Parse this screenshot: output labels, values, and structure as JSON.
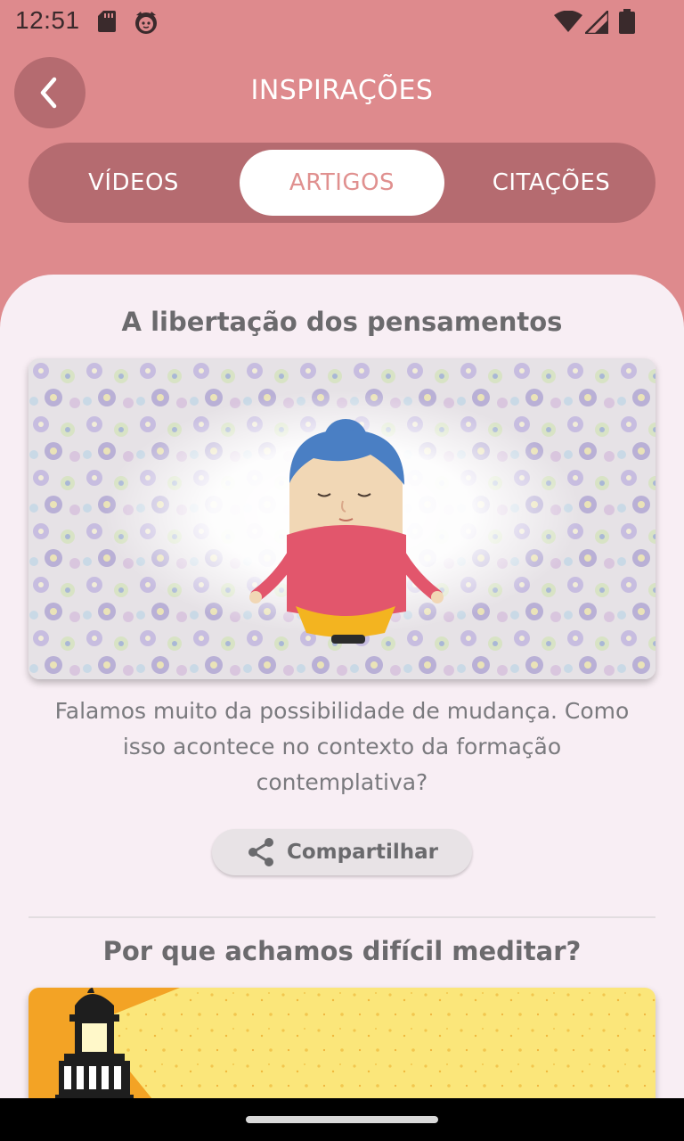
{
  "status_bar": {
    "time": "12:51",
    "icons": [
      "sd-card-icon",
      "cat-notification-icon",
      "wifi-icon",
      "signal-icon",
      "battery-icon"
    ]
  },
  "header": {
    "title": "INSPIRAÇÕES",
    "back_icon": "chevron-left-icon"
  },
  "tabs": [
    {
      "label": "VÍDEOS",
      "selected": false
    },
    {
      "label": "ARTIGOS",
      "selected": true
    },
    {
      "label": "CITAÇÕES",
      "selected": false
    }
  ],
  "articles": [
    {
      "title": "A libertação dos pensamentos",
      "description": "Falamos muito da possibilidade de mudança. Como isso acontece no contexto da formação contemplativa?",
      "share_label": "Compartilhar",
      "share_icon": "share-icon"
    },
    {
      "title": "Por que achamos difícil meditar?"
    }
  ],
  "colors": {
    "header_bg": "#de8a8d",
    "tab_bar_bg": "#b56b70",
    "selected_tab_text": "#e0908f",
    "content_bg": "#f8eef4",
    "text_gray": "#6b6a6d"
  }
}
